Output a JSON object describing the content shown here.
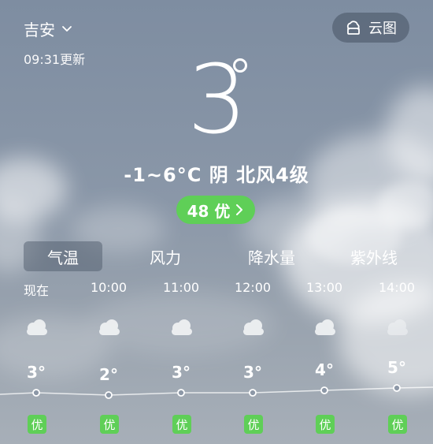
{
  "header": {
    "city": "吉安",
    "update_time": "09:31更新",
    "cloud_map_label": "云图"
  },
  "current": {
    "temperature": "3",
    "summary": "-1~6°C  阴  北风4级",
    "aqi_label": "48 优"
  },
  "tabs": [
    {
      "label": "气温",
      "active": true
    },
    {
      "label": "风力",
      "active": false
    },
    {
      "label": "降水量",
      "active": false
    },
    {
      "label": "紫外线",
      "active": false
    }
  ],
  "hourly": [
    {
      "time": "现在",
      "temp": "3°",
      "temp_value": 3,
      "aqi": "优",
      "icon": "cloudy-icon"
    },
    {
      "time": "10:00",
      "temp": "2°",
      "temp_value": 2,
      "aqi": "优",
      "icon": "cloudy-icon"
    },
    {
      "time": "11:00",
      "temp": "3°",
      "temp_value": 3,
      "aqi": "优",
      "icon": "cloudy-icon"
    },
    {
      "time": "12:00",
      "temp": "3°",
      "temp_value": 3,
      "aqi": "优",
      "icon": "cloudy-icon"
    },
    {
      "time": "13:00",
      "temp": "4°",
      "temp_value": 4,
      "aqi": "优",
      "icon": "cloudy-icon"
    },
    {
      "time": "14:00",
      "temp": "5°",
      "temp_value": 5,
      "aqi": "优",
      "icon": "cloudy-icon"
    }
  ],
  "colors": {
    "aqi_good": "#5fcf57",
    "background_top": "#7e8da1",
    "background_bottom": "#a7afb8"
  }
}
